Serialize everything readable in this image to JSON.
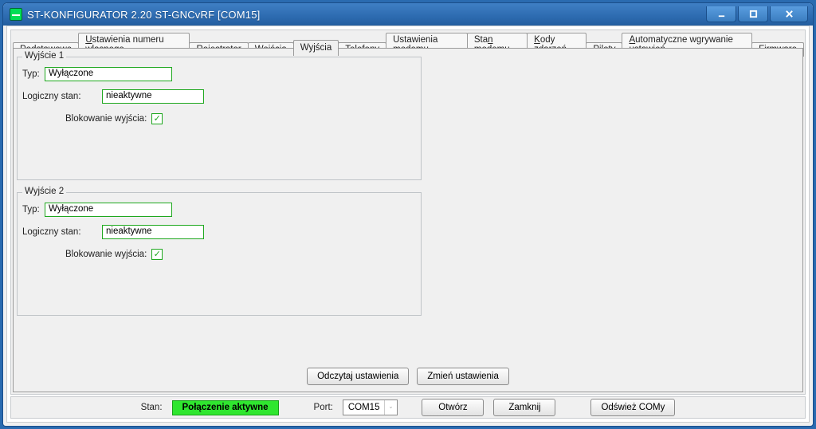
{
  "window": {
    "title": "ST-KONFIGURATOR 2.20 ST-GNCvRF   [COM15]"
  },
  "tabs": [
    {
      "label": "Podstawowe",
      "u": "P",
      "rest": "odstawowe"
    },
    {
      "label": "Ustawienia numeru własnego",
      "u": "U",
      "rest": "stawienia numeru własnego"
    },
    {
      "label": "Rejestrator",
      "u": "R",
      "rest": "ejestrator"
    },
    {
      "label": "Wejścia",
      "u": "W",
      "rest": "ejścia"
    },
    {
      "label": "Wyjścia",
      "u": "",
      "rest": "Wyjścia",
      "active": true
    },
    {
      "label": "Telefony",
      "u": "T",
      "rest": "elefony"
    },
    {
      "label": "Ustawienia modemu",
      "u": "",
      "rest": "Ustawienia ",
      "u2": "m",
      "rest2": "odemu"
    },
    {
      "label": "Stan modemu",
      "u": "",
      "rest": "Sta",
      "u2": "n",
      "rest2": " modemu"
    },
    {
      "label": "Kody zdarzeń",
      "u": "K",
      "rest": "ody ",
      "u2": "z",
      "rest2": "darzeń"
    },
    {
      "label": "Piloty",
      "u": "",
      "rest": "Pilot",
      "u2": "y",
      "rest2": ""
    },
    {
      "label": "Automatyczne wgrywanie ustawień",
      "u": "A",
      "rest": "utomatyczne wgrywanie ustawień"
    },
    {
      "label": "Firmware",
      "u": "F",
      "rest": "irmware"
    }
  ],
  "out1": {
    "legend": "Wyjście 1",
    "type_label": "Typ:",
    "type_value": "Wyłączone",
    "logic_label": "Logiczny stan:",
    "logic_value": "nieaktywne",
    "block_label": "Blokowanie wyjścia:",
    "block_checked": true
  },
  "out2": {
    "legend": "Wyjście 2",
    "type_label": "Typ:",
    "type_value": "Wyłączone",
    "logic_label": "Logiczny stan:",
    "logic_value": "nieaktywne",
    "block_label": "Blokowanie wyjścia:",
    "block_checked": true
  },
  "panel_buttons": {
    "read": "Odczytaj ustawienia",
    "write": "Zmień ustawienia"
  },
  "status": {
    "stan_label": "Stan:",
    "stan_value": "Połączenie aktywne",
    "port_label": "Port:",
    "port_value": "COM15",
    "open": "Otwórz",
    "close": "Zamknij",
    "refresh": "Odśwież COMy"
  }
}
